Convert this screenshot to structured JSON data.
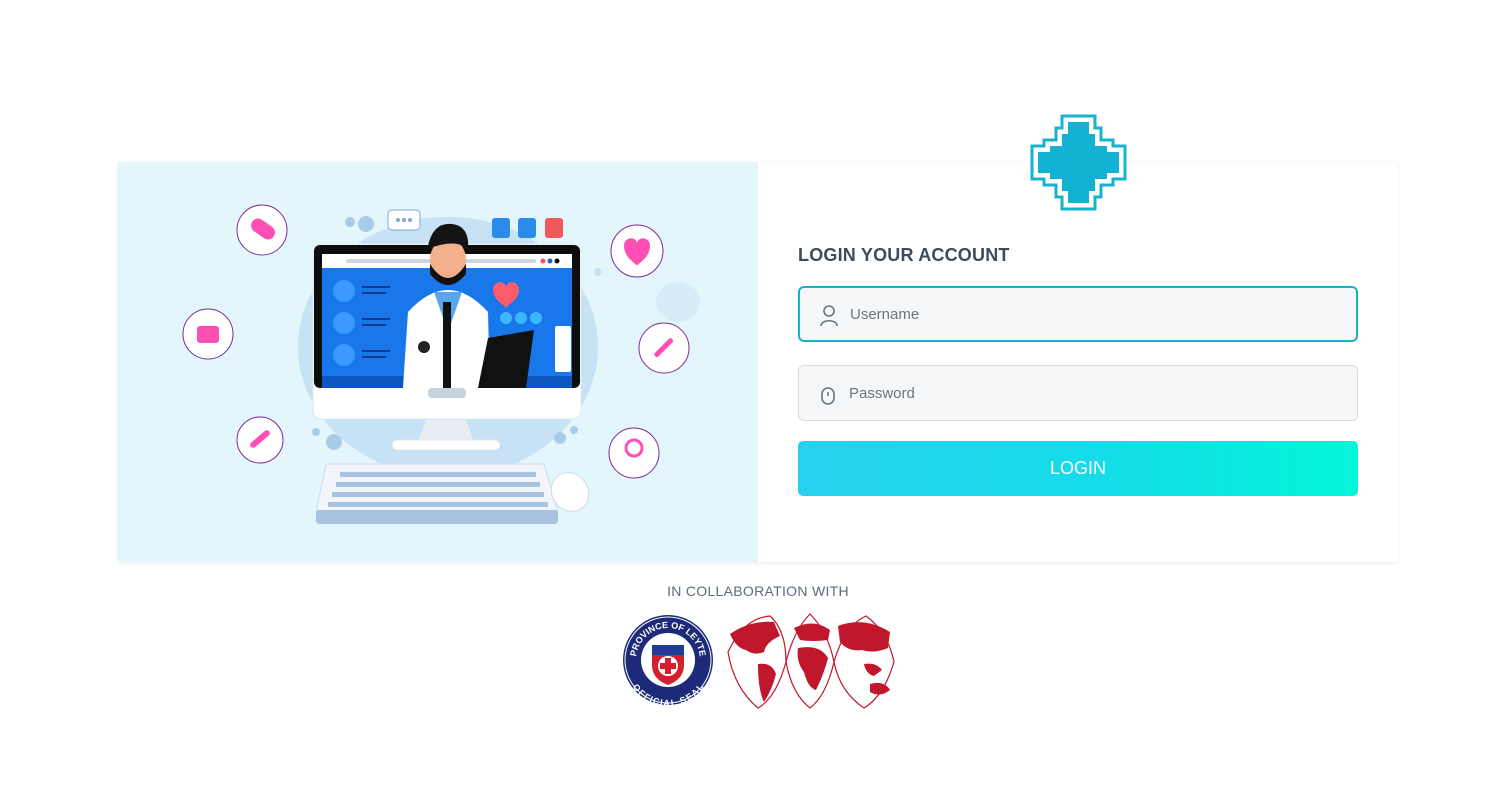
{
  "login": {
    "title": "LOGIN YOUR ACCOUNT",
    "username_placeholder": "Username",
    "username_value": "",
    "password_placeholder": "Password",
    "password_value": "",
    "button_label": "LOGIN"
  },
  "footer": {
    "collab_text": "IN COLLABORATION WITH",
    "seal_top_text": "PROVINCE OF LEYTE",
    "seal_bottom_text": "OFFICIAL SEAL"
  },
  "icons": {
    "brand": "medical-cross-icon",
    "username": "user-icon",
    "password": "lock-icon"
  },
  "colors": {
    "accent": "#16b3cc",
    "hero_background": "#e3f6fb",
    "button_gradient_start": "#27d0ee",
    "button_gradient_end": "#04f5d9",
    "map_red": "#c0172c",
    "seal_blue": "#1c2a78"
  }
}
